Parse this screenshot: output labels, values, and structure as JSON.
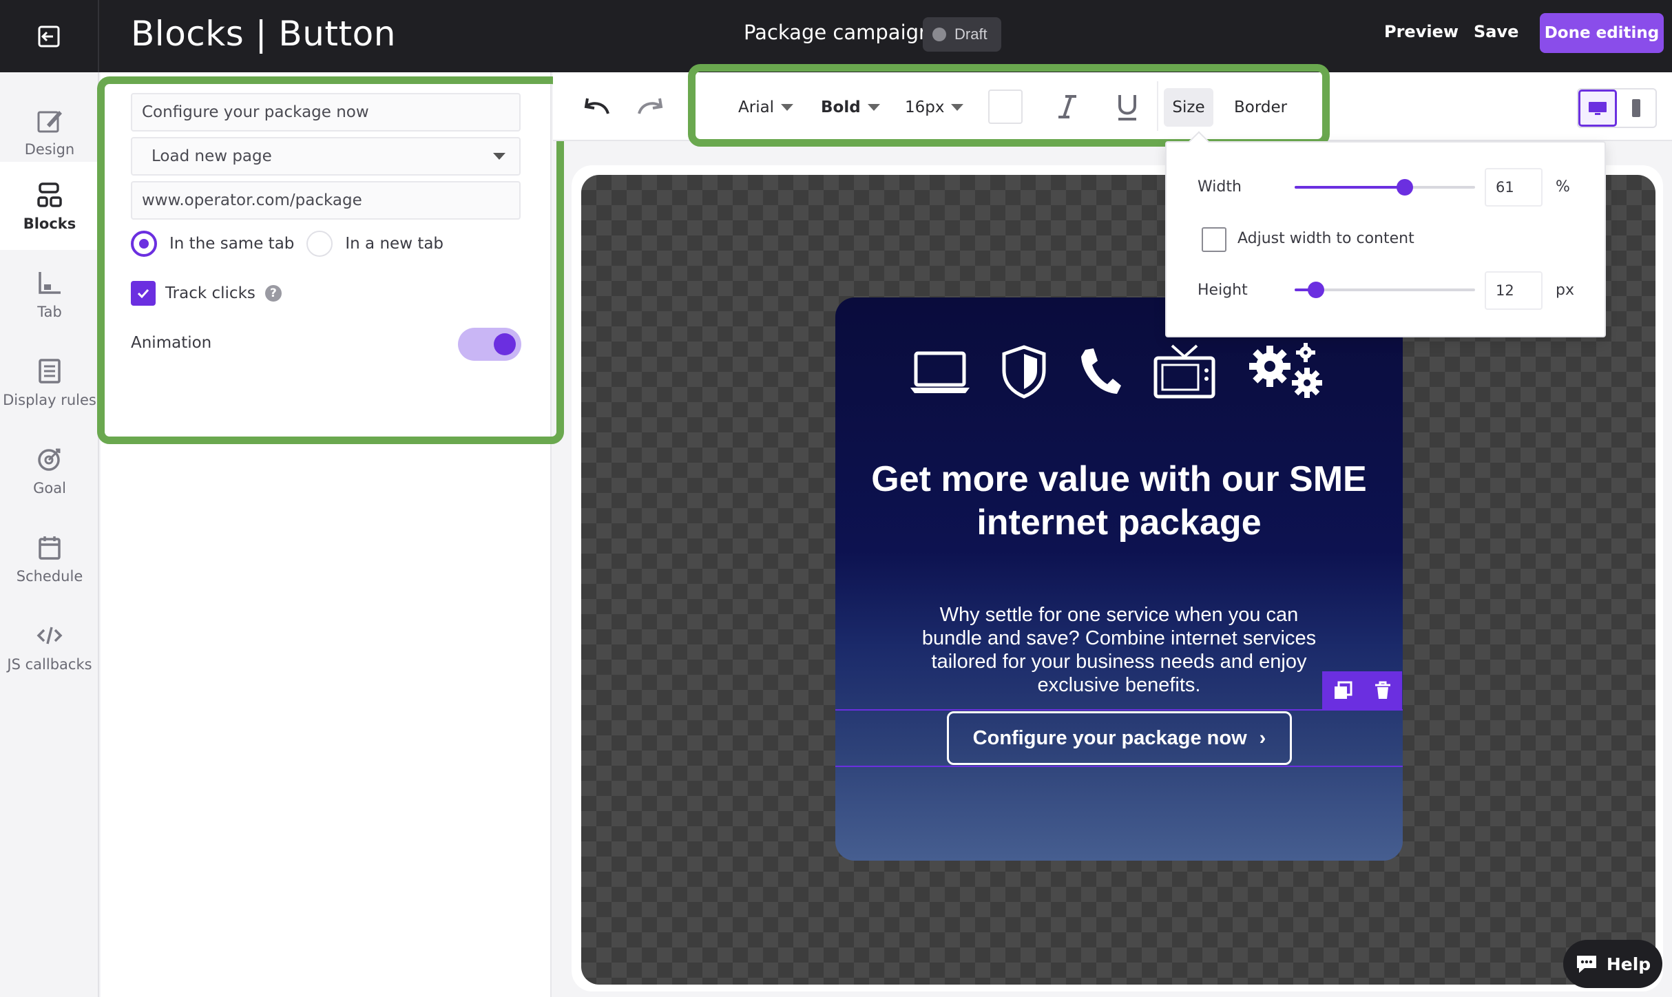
{
  "header": {
    "title": "Blocks | Button",
    "campaign": "Package campaign",
    "status": "Draft",
    "preview": "Preview",
    "save": "Save",
    "done": "Done editing"
  },
  "nav": {
    "items": [
      {
        "label": "Design",
        "icon": "design-icon"
      },
      {
        "label": "Blocks",
        "icon": "blocks-icon",
        "active": true
      },
      {
        "label": "Tab",
        "icon": "tab-icon"
      },
      {
        "label": "Display rules",
        "icon": "display-rules-icon"
      },
      {
        "label": "Goal",
        "icon": "goal-icon"
      },
      {
        "label": "Schedule",
        "icon": "calendar-icon"
      },
      {
        "label": "JS callbacks",
        "icon": "code-icon"
      }
    ]
  },
  "settings": {
    "button_text": "Configure your package now",
    "action": "Load new page",
    "url": "www.operator.com/package",
    "radio_same": "In the same tab",
    "radio_new": "In a new tab",
    "track_clicks": "Track clicks",
    "animation": "Animation"
  },
  "toolbar": {
    "font": "Arial",
    "weight": "Bold",
    "size": "16px",
    "size_tab": "Size",
    "border_tab": "Border"
  },
  "size_popover": {
    "width_label": "Width",
    "width_value": "61",
    "width_unit": "%",
    "adjust_label": "Adjust width to content",
    "height_label": "Height",
    "height_value": "12",
    "height_unit": "px"
  },
  "card": {
    "title": "Get more value with our SME internet package",
    "body": "Why settle for one service when you can bundle and save? Combine internet services tailored for your business needs and enjoy exclusive benefits.",
    "cta": "Configure your package now",
    "cta_arrow": "›"
  },
  "help": "Help",
  "colors": {
    "accent": "#6b2fe0",
    "done_button": "#8a4dea",
    "highlight": "#6aa84f"
  }
}
